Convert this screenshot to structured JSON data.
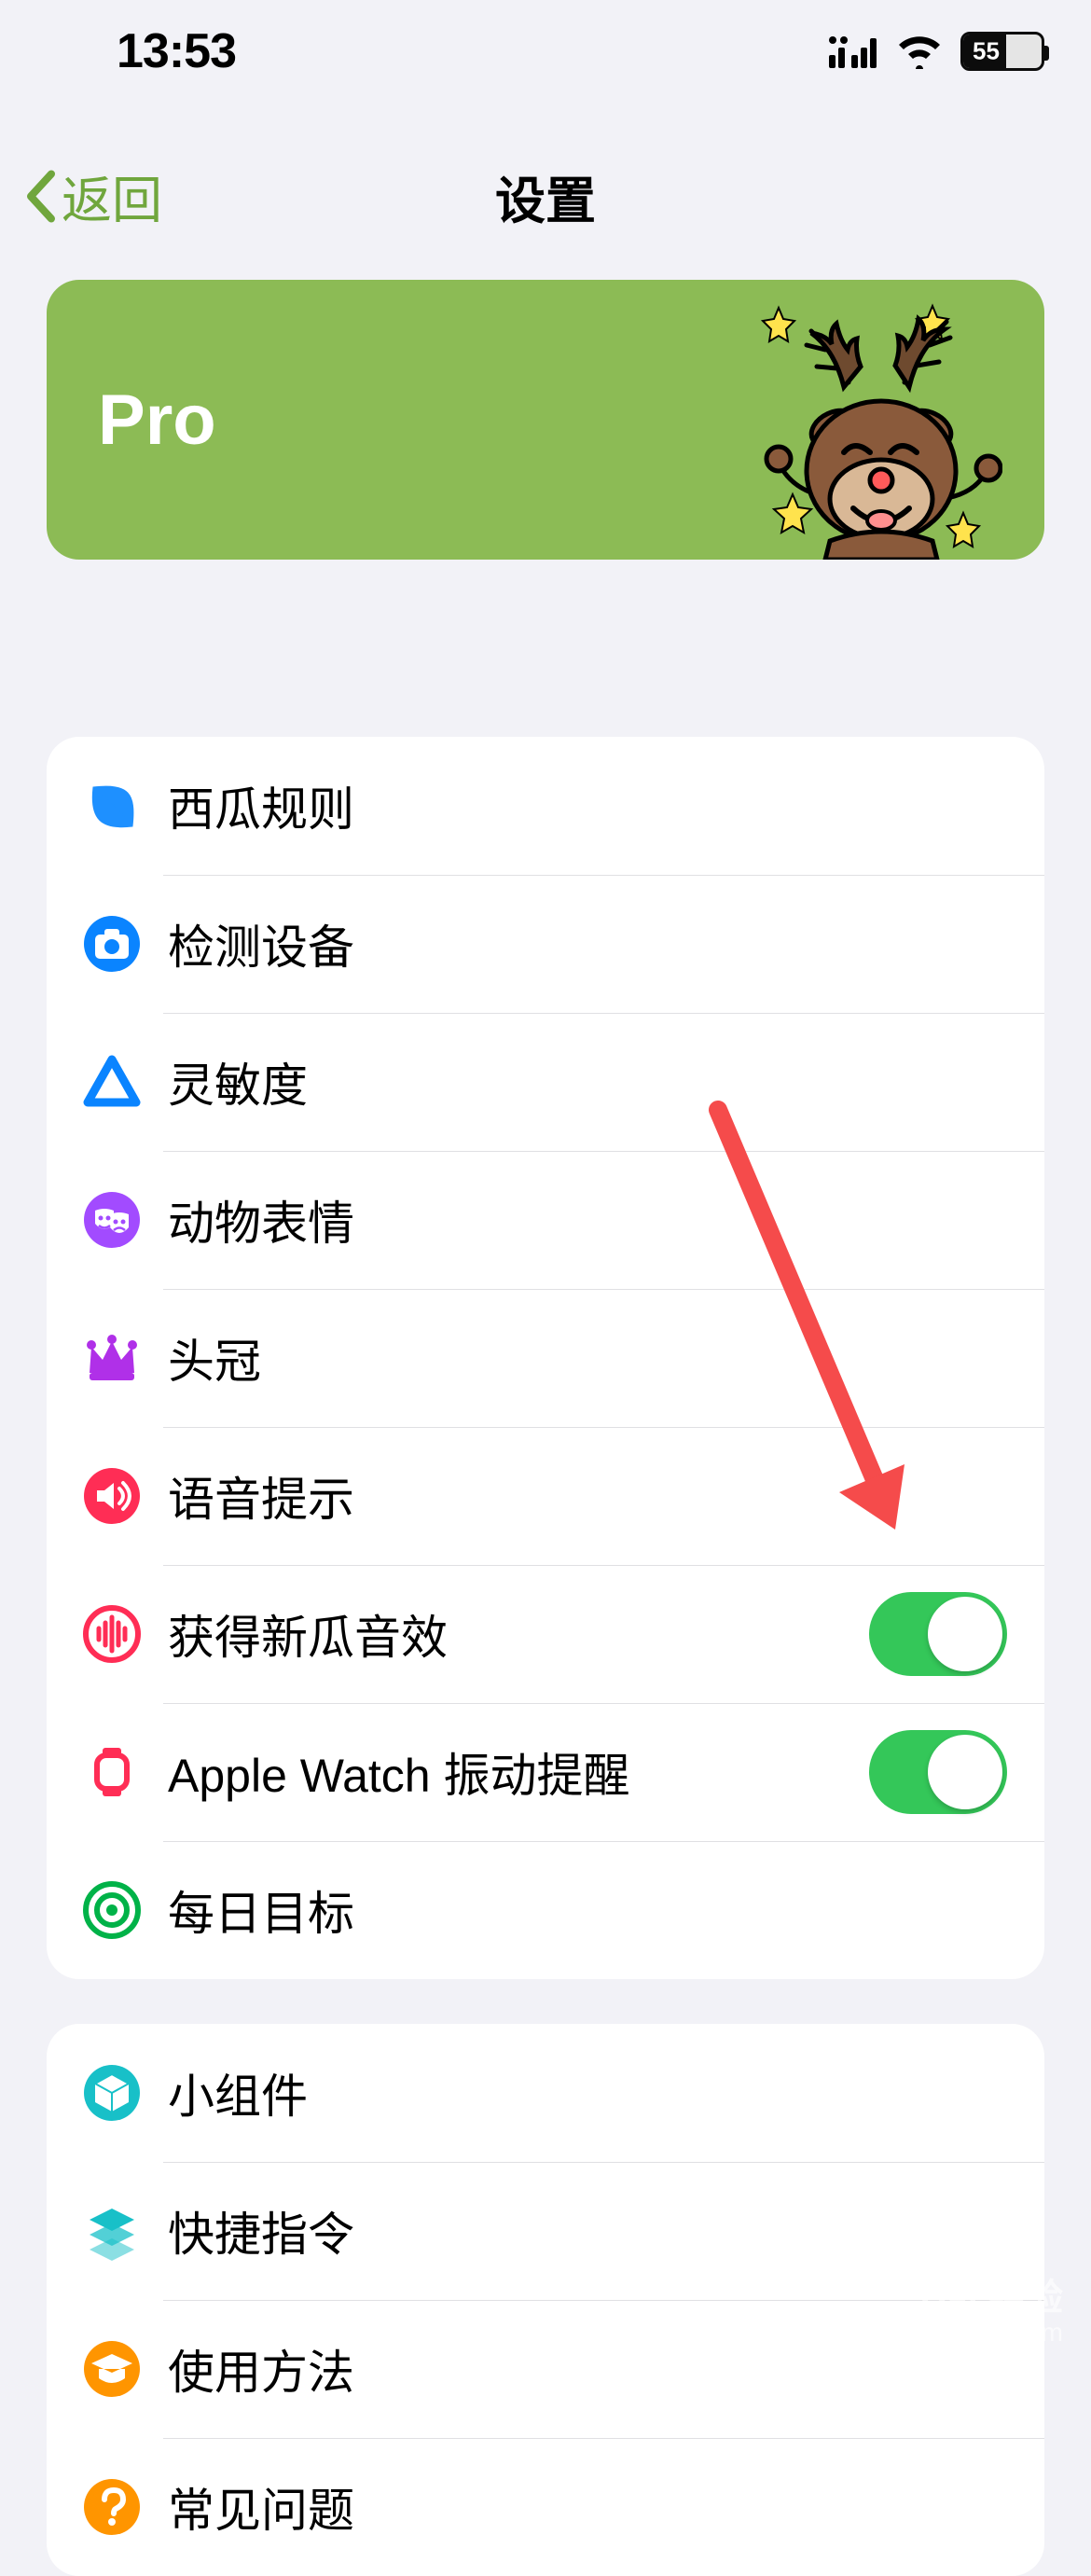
{
  "status": {
    "time": "13:53",
    "battery_percent": "55",
    "battery_fill_pct": 55
  },
  "nav": {
    "back_label": "返回",
    "title": "设置"
  },
  "pro_banner": {
    "label": "Pro"
  },
  "group1": {
    "items": [
      {
        "label": "西瓜规则"
      },
      {
        "label": "检测设备"
      },
      {
        "label": "灵敏度"
      },
      {
        "label": "动物表情"
      },
      {
        "label": "头冠"
      },
      {
        "label": "语音提示"
      },
      {
        "label": "获得新瓜音效",
        "toggle": true
      },
      {
        "label": "Apple Watch 振动提醒",
        "toggle": true
      },
      {
        "label": "每日目标"
      }
    ]
  },
  "group2": {
    "items": [
      {
        "label": "小组件"
      },
      {
        "label": "快捷指令"
      },
      {
        "label": "使用方法"
      },
      {
        "label": "常见问题"
      }
    ]
  },
  "colors": {
    "accent_green": "#70a63d",
    "banner_green": "#8cbb55",
    "toggle_green": "#34c759",
    "arrow_red": "#f54b4b"
  },
  "watermark": {
    "line1": "Bai 经验",
    "line2": "jingyan.baidu.com"
  }
}
